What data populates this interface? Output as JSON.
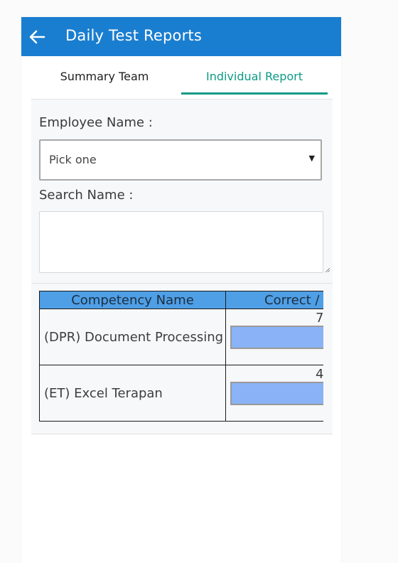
{
  "app": {
    "title": "Daily Test Reports",
    "back_icon": "arrow-left-icon",
    "accent_color": "#1a7ed0"
  },
  "tabs": [
    {
      "label": "Summary Team",
      "active": false
    },
    {
      "label": "Individual Report",
      "active": true,
      "color": "#0e9a86"
    }
  ],
  "form": {
    "employee_label": "Employee Name :",
    "employee_select": {
      "value": "Pick one",
      "arrow": "▼"
    },
    "search_label": "Search Name :",
    "search_value": ""
  },
  "table": {
    "headers": {
      "name": "Competency Name",
      "correct": "Correct /"
    },
    "rows": [
      {
        "name": "(DPR) Document Processing",
        "correct": "7",
        "bar_color": "#89b3f6"
      },
      {
        "name": "(ET) Excel Terapan",
        "correct": "4",
        "bar_color": "#89b3f6"
      }
    ]
  }
}
